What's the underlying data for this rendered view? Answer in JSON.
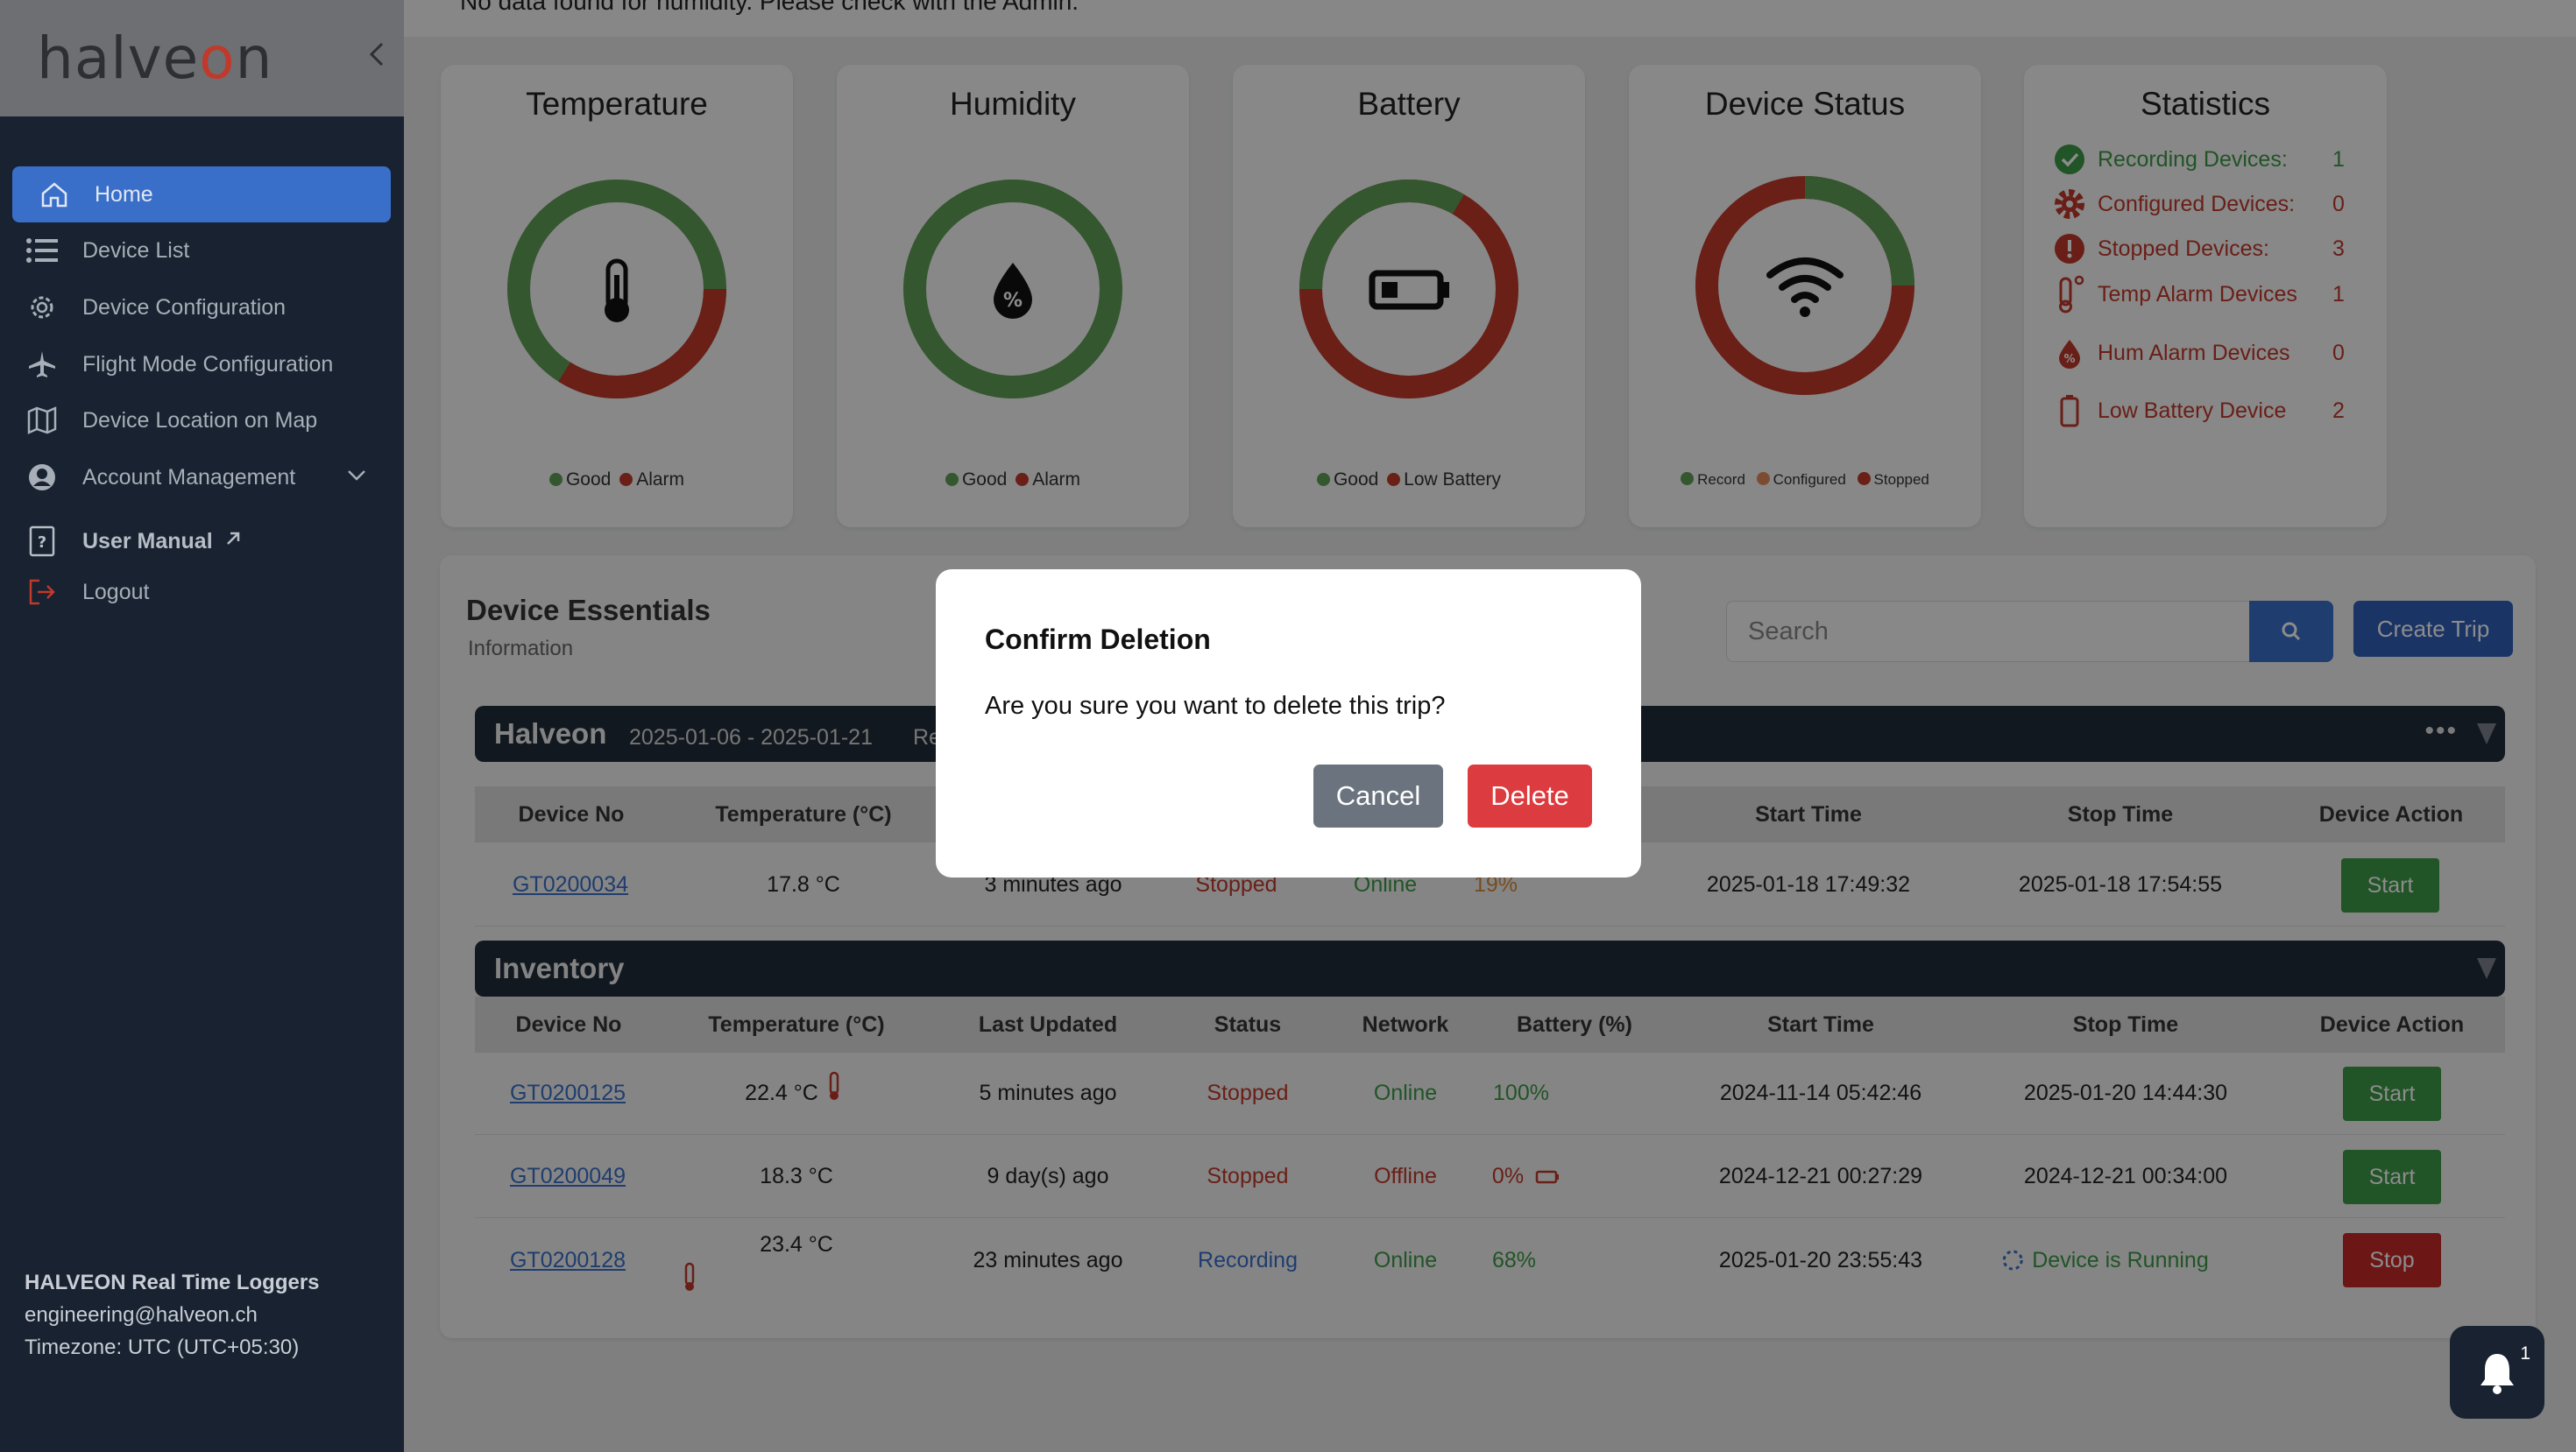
{
  "sidebar": {
    "logo": "halveon",
    "nav": [
      {
        "label": "Home",
        "icon": "home-icon",
        "active": true
      },
      {
        "label": "Device List",
        "icon": "list-icon"
      },
      {
        "label": "Device Configuration",
        "icon": "gear-icon"
      },
      {
        "label": "Flight Mode Configuration",
        "icon": "airplane-icon"
      },
      {
        "label": "Device Location on Map",
        "icon": "map-icon"
      },
      {
        "label": "Account Management",
        "icon": "account-icon"
      },
      {
        "label": "User Manual",
        "icon": "manual-icon"
      },
      {
        "label": "Logout",
        "icon": "logout-icon"
      }
    ],
    "footer": {
      "company": "HALVEON Real Time Loggers",
      "email": "engineering@halveon.ch",
      "timezone": "Timezone: UTC (UTC+05:30)"
    }
  },
  "banner": "No data found for humidity. Please check with the Admin.",
  "cards": {
    "temperature": {
      "title": "Temperature",
      "legend": [
        "Good",
        "Alarm"
      ],
      "good": 0.66,
      "alarm": 0.34
    },
    "humidity": {
      "title": "Humidity",
      "legend": [
        "Good",
        "Alarm"
      ],
      "good": 1,
      "alarm": 0
    },
    "battery": {
      "title": "Battery",
      "legend": [
        "Good",
        "Low Battery"
      ],
      "good": 0.33,
      "alarm": 0.67
    },
    "status": {
      "title": "Device Status",
      "legend": [
        "Record",
        "Configured",
        "Stopped"
      ],
      "record": 0.25,
      "configured": 0,
      "stopped": 0.75
    }
  },
  "statistics": {
    "title": "Statistics",
    "rows": [
      {
        "label": "Recording Devices:",
        "value": "1",
        "color": "#3c9a46"
      },
      {
        "label": "Configured Devices:",
        "value": "0",
        "color": "#c0392b"
      },
      {
        "label": "Stopped Devices:",
        "value": "3",
        "color": "#c0392b"
      },
      {
        "label": "Temp Alarm Devices",
        "value": "1",
        "color": "#c0392b"
      },
      {
        "label": "Hum Alarm Devices",
        "value": "0",
        "color": "#c0392b"
      },
      {
        "label": "Low Battery Device",
        "value": "2",
        "color": "#c0392b"
      }
    ]
  },
  "essentials": {
    "title": "Device Essentials",
    "subtitle": "Information",
    "search_placeholder": "Search",
    "create_label": "Create Trip"
  },
  "group1": {
    "name": "Halveon",
    "dates": "2025-01-06 - 2025-01-21",
    "more": "Re",
    "headers": [
      "Device No",
      "Temperature (°C)",
      "Start Time",
      "Stop Time",
      "Device Action"
    ],
    "rows": [
      {
        "device": "GT0200034",
        "temp": "17.8 °C",
        "updated": "3 minutes ago",
        "status": "Stopped",
        "network": "Online",
        "battery": "19%",
        "start": "2025-01-18 17:49:32",
        "stop": "2025-01-18 17:54:55",
        "action": "Start"
      }
    ]
  },
  "group2": {
    "name": "Inventory",
    "headers": [
      "Device No",
      "Temperature (°C)",
      "Last Updated",
      "Status",
      "Network",
      "Battery (%)",
      "Start Time",
      "Stop Time",
      "Device Action"
    ],
    "rows": [
      {
        "device": "GT0200125",
        "temp": "22.4 °C",
        "updated": "5 minutes ago",
        "status": "Stopped",
        "network": "Online",
        "battery": "100%",
        "start": "2024-11-14 05:42:46",
        "stop": "2025-01-20 14:44:30",
        "action": "Start"
      },
      {
        "device": "GT0200049",
        "temp": "18.3 °C",
        "updated": "9 day(s) ago",
        "status": "Stopped",
        "network": "Offline",
        "battery": "0%",
        "start": "2024-12-21 00:27:29",
        "stop": "2024-12-21 00:34:00",
        "action": "Start"
      },
      {
        "device": "GT0200128",
        "temp": "23.4 °C",
        "updated": "23 minutes ago",
        "status": "Recording",
        "network": "Online",
        "battery": "68%",
        "start": "2025-01-20 23:55:43",
        "stop": "Device is Running",
        "action": "Stop"
      }
    ]
  },
  "modal": {
    "title": "Confirm Deletion",
    "message": "Are you sure you want to delete this trip?",
    "cancel": "Cancel",
    "delete": "Delete"
  },
  "notifications": {
    "count": "1"
  }
}
